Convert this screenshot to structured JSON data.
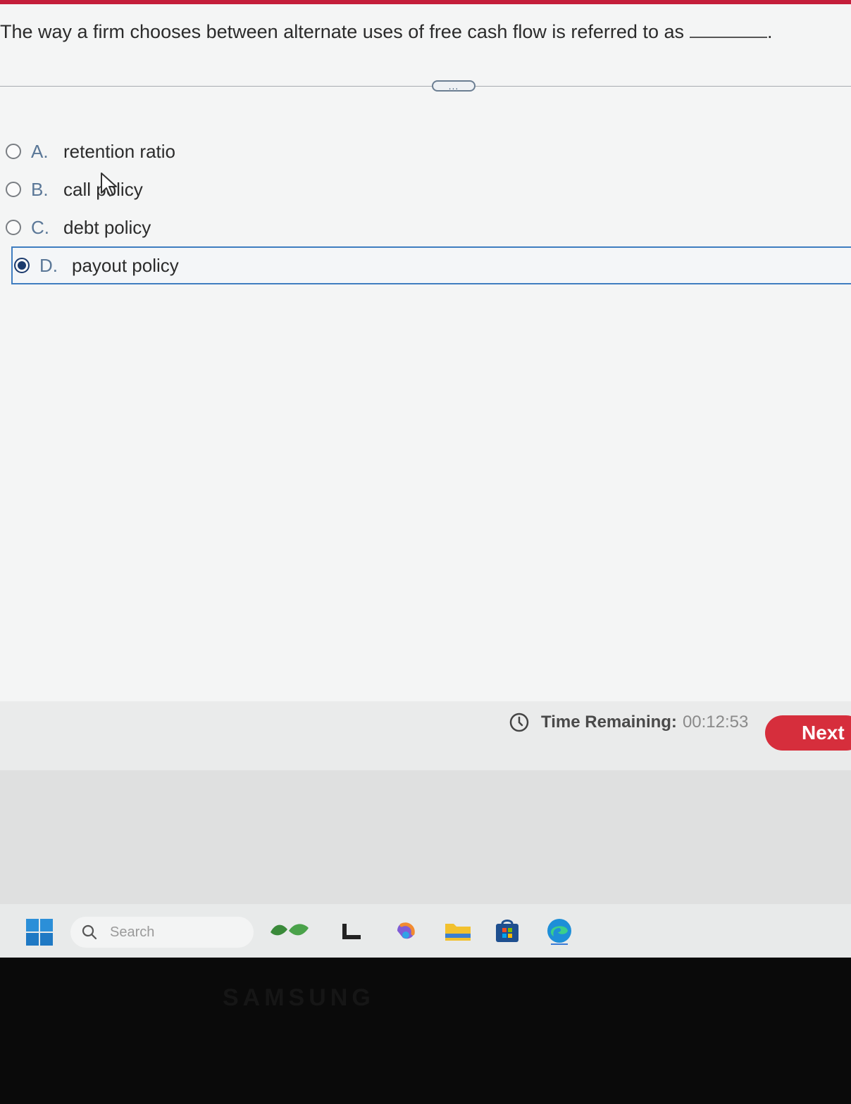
{
  "question": {
    "text": "The way a firm chooses between alternate uses of free cash flow is referred to as",
    "end_punct": "."
  },
  "expander": {
    "label": "..."
  },
  "options": [
    {
      "letter": "A.",
      "text": "retention ratio",
      "selected": false
    },
    {
      "letter": "B.",
      "text": "call policy",
      "selected": false
    },
    {
      "letter": "C.",
      "text": "debt policy",
      "selected": false
    },
    {
      "letter": "D.",
      "text": "payout policy",
      "selected": true
    }
  ],
  "footer": {
    "time_label": "Time Remaining:",
    "time_value": "00:12:53",
    "next_label": "Next"
  },
  "taskbar": {
    "search_placeholder": "Search",
    "icons": [
      "windows-start-icon",
      "search-icon",
      "widgets-icon",
      "task-view-icon",
      "copilot-icon",
      "file-explorer-icon",
      "microsoft-store-icon",
      "edge-icon"
    ]
  },
  "bezel": {
    "brand": "SAMSUNG"
  },
  "colors": {
    "accent_red": "#d62e3c",
    "selected_blue": "#3f7dc0",
    "radio_fill": "#1c3b6e"
  }
}
